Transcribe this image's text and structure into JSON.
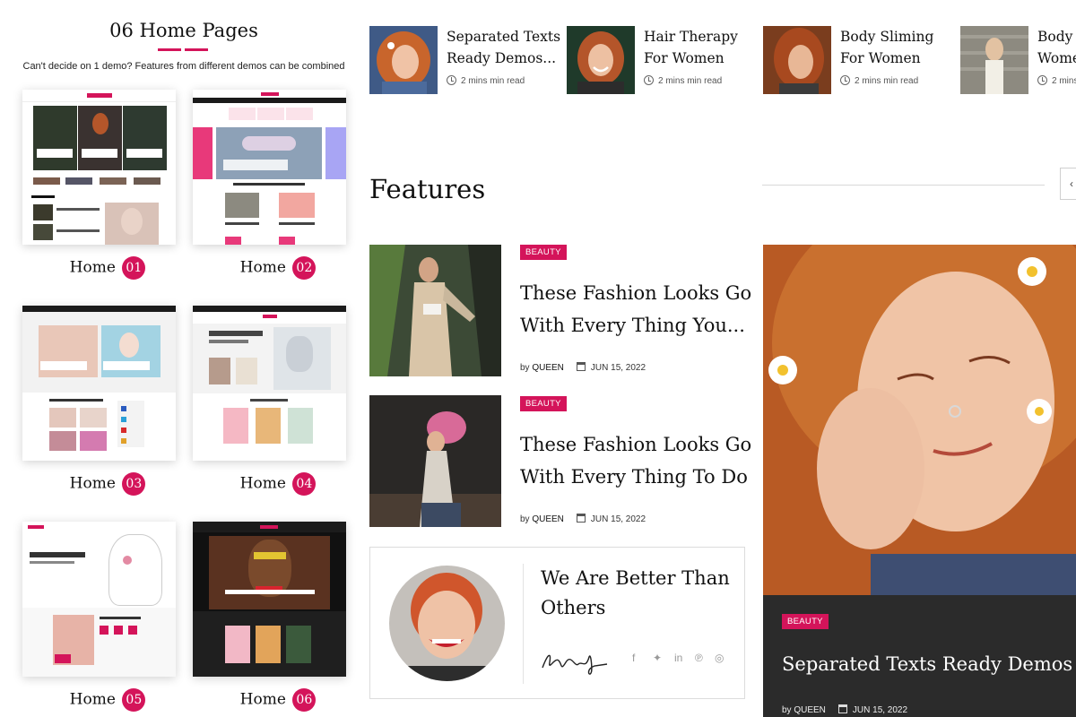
{
  "left": {
    "title": "06 Home Pages",
    "subtitle": "Can't decide on 1 demo? Features from different demos can be combined",
    "homes": [
      {
        "label": "Home",
        "num": "01"
      },
      {
        "label": "Home",
        "num": "02"
      },
      {
        "label": "Home",
        "num": "03"
      },
      {
        "label": "Home",
        "num": "04"
      },
      {
        "label": "Home",
        "num": "05"
      },
      {
        "label": "Home",
        "num": "06"
      }
    ]
  },
  "strip": [
    {
      "title_l1": "Separated Texts",
      "title_l2": "Ready Demos...",
      "meta": "2 mins min read"
    },
    {
      "title_l1": "Hair Therapy",
      "title_l2": "For Women",
      "meta": "2 mins min read"
    },
    {
      "title_l1": "Body Sliming",
      "title_l2": "For Women",
      "meta": "2 mins min read"
    },
    {
      "title_l1": "Body L",
      "title_l2": "Wome",
      "meta": "2 mins min read"
    }
  ],
  "features": {
    "heading": "Features",
    "prev_arrow": "‹",
    "posts": [
      {
        "badge": "BEAUTY",
        "title_l1": "These Fashion Looks Go",
        "title_l2": "With Every Thing You...",
        "by": "by",
        "author": "QUEEN",
        "date": "JUN 15, 2022"
      },
      {
        "badge": "BEAUTY",
        "title_l1": "These Fashion Looks Go",
        "title_l2": "With Every Thing To Do",
        "by": "by",
        "author": "QUEEN",
        "date": "JUN 15, 2022"
      }
    ],
    "better": {
      "title_l1": "We Are Better Than",
      "title_l2": "Others"
    },
    "social_icons": [
      "facebook-icon",
      "twitter-icon",
      "linkedin-icon",
      "pinterest-icon",
      "instagram-icon"
    ],
    "hero": {
      "badge": "BEAUTY",
      "title": "Separated Texts Ready Demos de",
      "by": "by",
      "author": "QUEEN",
      "date": "JUN 15, 2022"
    }
  },
  "colors": {
    "accent": "#d4145a",
    "dark": "#2b2b2b"
  }
}
